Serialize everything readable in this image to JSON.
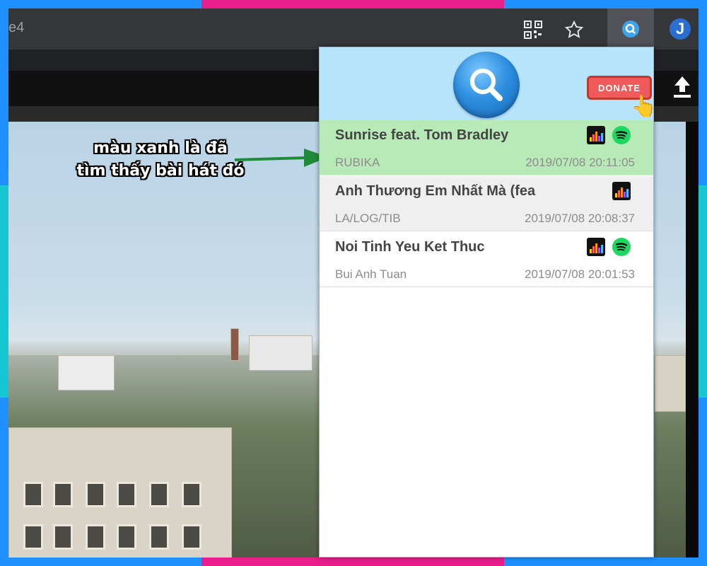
{
  "browser": {
    "url_fragment": "e4",
    "qr_icon": "qr-code-icon",
    "star_icon": "bookmark-star-icon",
    "extension_icon": "song-search-extension-icon",
    "profile_icon": "j-extension-icon",
    "upload_icon": "upload-icon"
  },
  "annotation": {
    "line1": "màu xanh là đã",
    "line2": "tìm thấy bài hát đó",
    "arrow_color": "#1f8a3a"
  },
  "popup": {
    "logo_icon": "magnifier-logo-icon",
    "donate_label": "DONATE",
    "songs": [
      {
        "title": "Sunrise feat. Tom Bradley",
        "artist": "RUBIKA",
        "time": "2019/07/08 20:11:05",
        "status": "found",
        "services": [
          "deezer",
          "spotify"
        ]
      },
      {
        "title": "Anh Thương Em Nhất Mà (fea",
        "artist": "LA/LOG/TIB",
        "time": "2019/07/08 20:08:37",
        "status": "not-found",
        "services": [
          "deezer"
        ]
      },
      {
        "title": "Noi Tinh Yeu Ket Thuc",
        "artist": "Bui Anh Tuan",
        "time": "2019/07/08 20:01:53",
        "status": "plain",
        "services": [
          "deezer",
          "spotify"
        ]
      }
    ]
  },
  "colors": {
    "found_row": "#b8eab7",
    "header_bg": "#b6e4fb",
    "donate_bg": "#f05a5a",
    "frame_blue": "#1e90ff",
    "frame_pink": "#e91e8c",
    "frame_teal": "#17c6d3"
  }
}
